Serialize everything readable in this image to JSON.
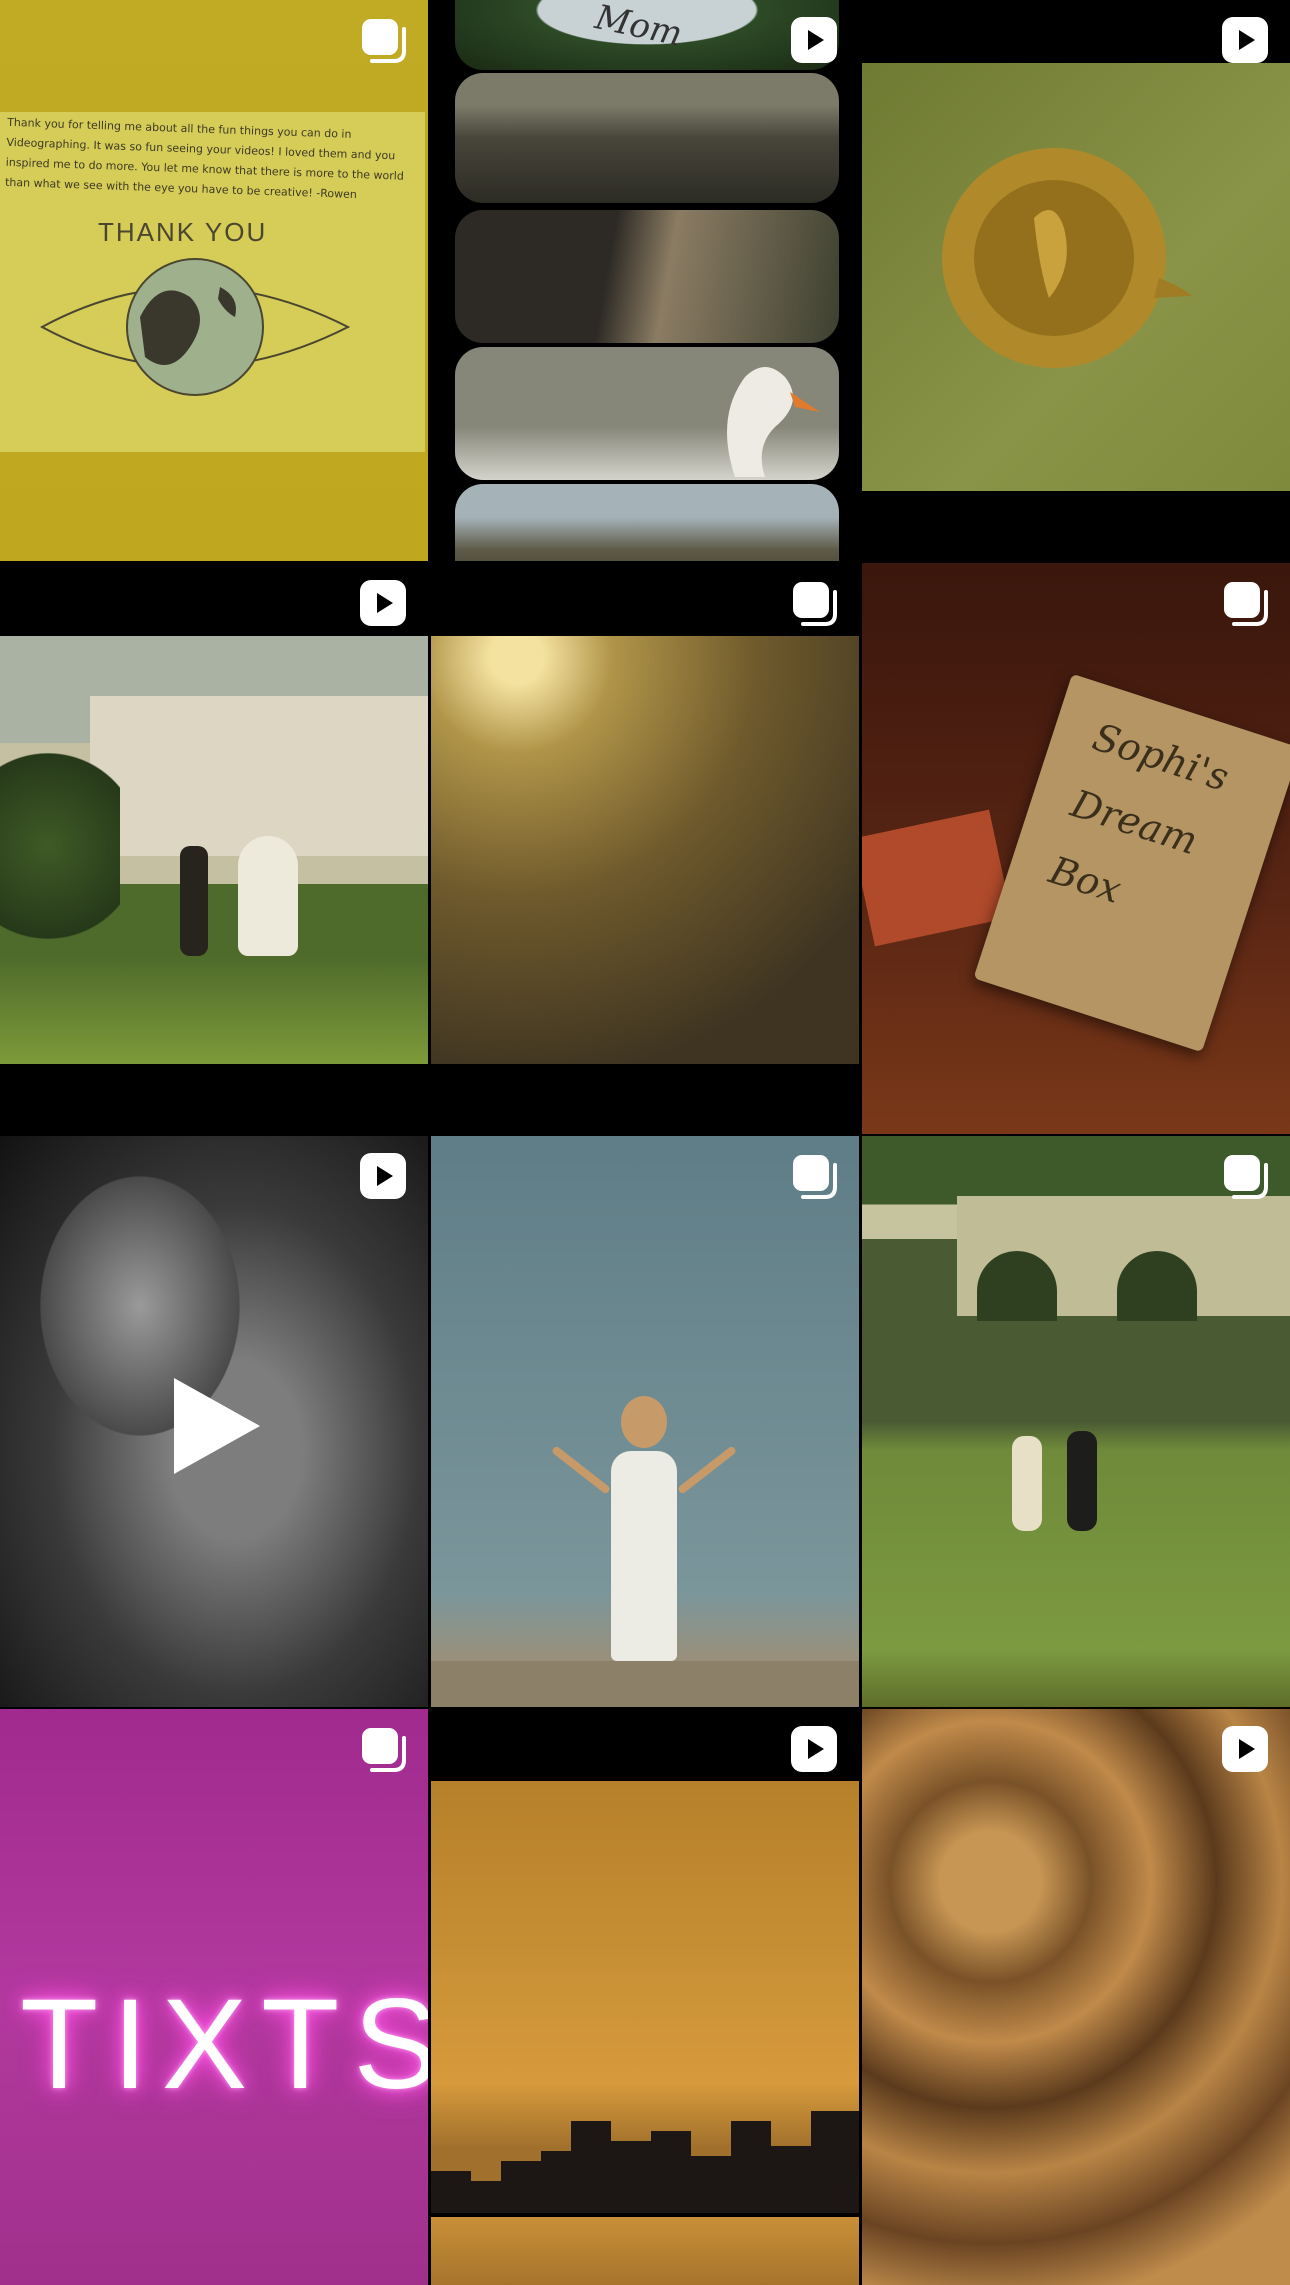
{
  "grid": {
    "tiles": [
      {
        "badge": "carousel-icon",
        "note_text": "Thank you for telling me about all the fun things you can do in Videographing. It was so fun seeing your videos! I loved them and you inspired me to do more. You let me know that there is more to the world than what we see with the eye you have to be creative! -Rowen",
        "headline": "THANK YOU"
      },
      {
        "badge": "play-icon",
        "cake_text": "Mom"
      },
      {
        "badge": "play-icon"
      },
      {
        "badge": "play-icon"
      },
      {
        "badge": "carousel-icon"
      },
      {
        "badge": "carousel-icon",
        "journal": [
          "Sophi's",
          "Dream",
          "Box"
        ]
      },
      {
        "badge": "play-icon",
        "center_icon": "play-icon"
      },
      {
        "badge": "carousel-icon"
      },
      {
        "badge": "carousel-icon"
      },
      {
        "badge": "carousel-icon",
        "neon_text": "TIXTS"
      },
      {
        "badge": "play-icon"
      },
      {
        "badge": "play-icon"
      }
    ]
  }
}
